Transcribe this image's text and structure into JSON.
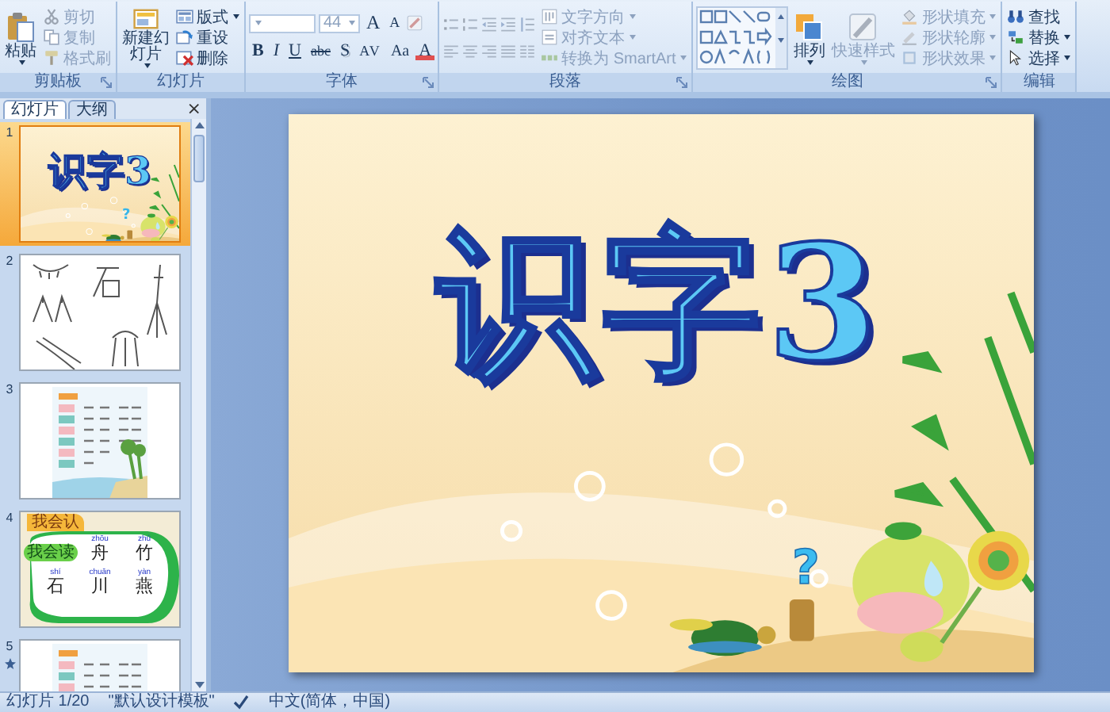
{
  "ribbon": {
    "groups": [
      {
        "label": "剪贴板",
        "kind": "buttons",
        "launcher": true,
        "items": [
          {
            "kind": "large",
            "label": "粘贴",
            "disabled": false,
            "dropdown": true
          },
          {
            "kind": "small",
            "label": "剪切",
            "disabled": true,
            "dropdown": false
          },
          {
            "kind": "small",
            "label": "复制",
            "disabled": true,
            "dropdown": false
          },
          {
            "kind": "small",
            "label": "格式刷",
            "disabled": true,
            "dropdown": false
          }
        ]
      },
      {
        "label": "幻灯片",
        "kind": "buttons",
        "launcher": false,
        "items": [
          {
            "kind": "large",
            "label": "新建幻灯片",
            "disabled": false,
            "dropdown": true
          },
          {
            "kind": "small",
            "label": "版式",
            "disabled": false,
            "dropdown": true
          },
          {
            "kind": "small",
            "label": "重设",
            "disabled": false,
            "dropdown": false
          },
          {
            "kind": "small",
            "label": "删除",
            "disabled": false,
            "dropdown": false
          }
        ]
      },
      {
        "label": "字体",
        "kind": "font",
        "launcher": true,
        "disabled": true,
        "font_size": "44",
        "size_buttons": [
          {
            "kind": "grow",
            "label": "A"
          },
          {
            "kind": "shrink",
            "label": "A"
          }
        ],
        "format_buttons": [
          {
            "kind": "bold",
            "label": "B"
          },
          {
            "kind": "italic",
            "label": "I"
          },
          {
            "kind": "underline",
            "label": "U"
          },
          {
            "kind": "strike",
            "label": "abc"
          },
          {
            "kind": "shadow",
            "label": "S"
          },
          {
            "kind": "spacing",
            "label": "AV"
          },
          {
            "kind": "case",
            "label": "Aa"
          },
          {
            "kind": "color",
            "label": "A"
          }
        ]
      },
      {
        "label": "段落",
        "kind": "paragraph",
        "launcher": true,
        "items": [
          {
            "kind": "small",
            "label": "文字方向",
            "disabled": true,
            "dropdown": true
          },
          {
            "kind": "small",
            "label": "对齐文本",
            "disabled": true,
            "dropdown": true
          },
          {
            "kind": "small",
            "label": "转换为 SmartArt",
            "disabled": true,
            "dropdown": true
          }
        ]
      },
      {
        "label": "绘图",
        "kind": "drawing",
        "launcher": true,
        "items": [
          {
            "kind": "large",
            "label": "排列",
            "disabled": false,
            "dropdown": true
          },
          {
            "kind": "large",
            "label": "快速样式",
            "disabled": true,
            "dropdown": true
          },
          {
            "kind": "small",
            "label": "形状填充",
            "disabled": true,
            "dropdown": true
          },
          {
            "kind": "small",
            "label": "形状轮廓",
            "disabled": true,
            "dropdown": true
          },
          {
            "kind": "small",
            "label": "形状效果",
            "disabled": true,
            "dropdown": true
          }
        ]
      },
      {
        "label": "编辑",
        "kind": "buttons",
        "launcher": false,
        "items": [
          {
            "kind": "small",
            "label": "查找",
            "disabled": false,
            "dropdown": false
          },
          {
            "kind": "small",
            "label": "替换",
            "disabled": false,
            "dropdown": true
          },
          {
            "kind": "small",
            "label": "选择",
            "disabled": false,
            "dropdown": true
          }
        ]
      }
    ]
  },
  "slide_panel": {
    "tabs": [
      {
        "label": "幻灯片",
        "selected": true
      },
      {
        "label": "大纲",
        "selected": false
      }
    ],
    "close": "×",
    "slides": [
      {
        "number": "1",
        "selected": true,
        "animated": false,
        "kind": "title",
        "title": "识字3",
        "mark": "?"
      },
      {
        "number": "2",
        "selected": false,
        "animated": false,
        "kind": "sketches"
      },
      {
        "number": "3",
        "selected": false,
        "animated": false,
        "kind": "table"
      },
      {
        "number": "4",
        "selected": false,
        "animated": false,
        "kind": "characters",
        "tag": "我会认",
        "badge": "我会读",
        "rows": [
          [
            "",
            {
              "pinyin": "zhōu",
              "hanzi": "舟"
            },
            {
              "pinyin": "zhú",
              "hanzi": "竹"
            }
          ],
          [
            {
              "pinyin": "shí",
              "hanzi": "石"
            },
            {
              "pinyin": "chuān",
              "hanzi": "川"
            },
            {
              "pinyin": "yàn",
              "hanzi": "燕"
            }
          ]
        ]
      },
      {
        "number": "5",
        "selected": false,
        "animated": true,
        "kind": "table"
      }
    ]
  },
  "slide": {
    "title": "识字3",
    "mark": "?"
  },
  "status_bar": {
    "slide_info": "幻灯片 1/20",
    "theme": "\"默认设计模板\"",
    "language": "中文(简体，中国)"
  }
}
